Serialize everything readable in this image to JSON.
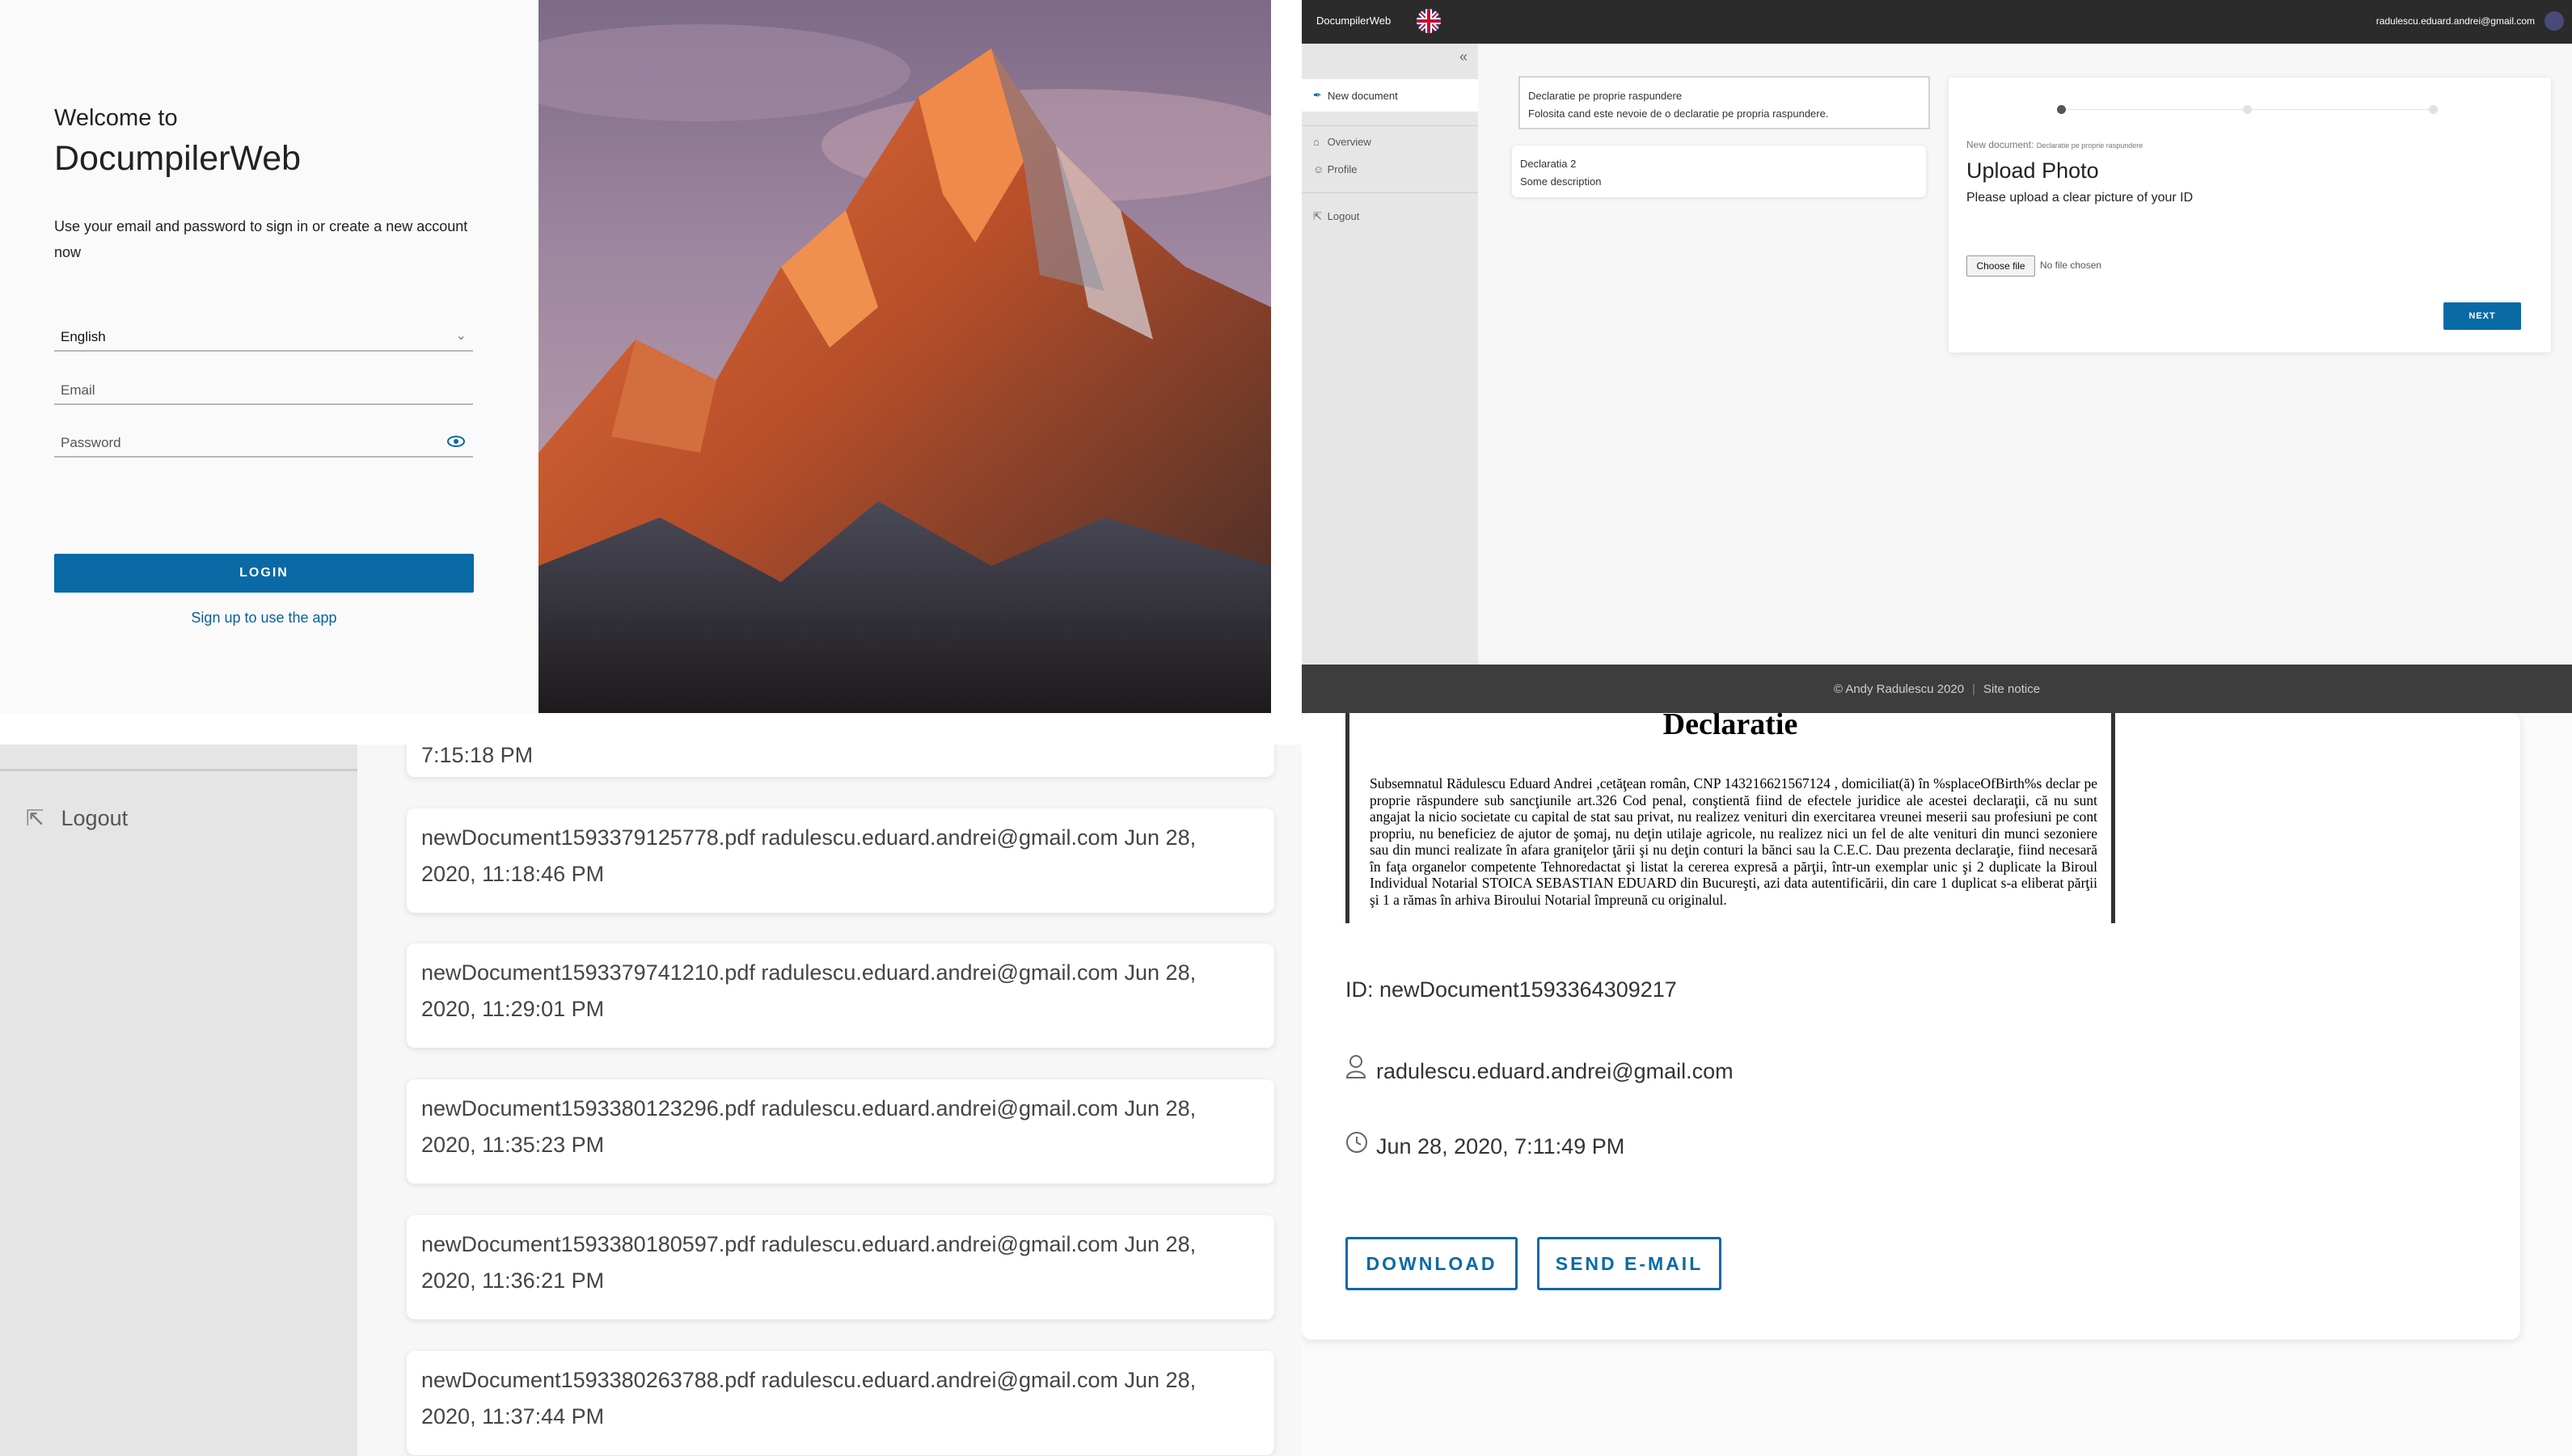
{
  "login": {
    "welcome": "Welcome to",
    "app_name": "DocumpilerWeb",
    "subtitle": "Use your email and password to sign in or create a new account now",
    "language": "English",
    "email_placeholder": "Email",
    "password_placeholder": "Password",
    "login_label": "LOGIN",
    "signup_label": "Sign up to use the app"
  },
  "upload": {
    "brand": "DocumpilerWeb",
    "user_email": "radulescu.eduard.andrei@gmail.com",
    "sidebar": {
      "new_document": "New document",
      "overview": "Overview",
      "profile": "Profile",
      "logout": "Logout"
    },
    "cards": [
      {
        "title": "Declaratie pe proprie raspundere",
        "description": "Folosita cand este nevoie de o declaratie pe propria raspundere."
      },
      {
        "title": "Declaratia 2",
        "description": "Some description"
      }
    ],
    "wizard": {
      "crumb": "New document:",
      "crumb_doc": "Declaratie pe proprie raspundere",
      "title": "Upload Photo",
      "instruction": "Please upload a clear picture of your ID",
      "choose_file": "Choose file",
      "no_file": "No file chosen",
      "next": "NEXT",
      "current_step": 1,
      "total_steps": 3
    },
    "footer": {
      "copyright": "© Andy Radulescu 2020",
      "site_notice": "Site notice"
    }
  },
  "list": {
    "partial_time": "7:15:18 PM",
    "logout": "Logout",
    "documents": [
      {
        "name": "newDocument1593379125778.pdf",
        "email": "radulescu.eduard.andrei@gmail.com",
        "date": "Jun 28,",
        "time": "2020, 11:18:46 PM"
      },
      {
        "name": "newDocument1593379741210.pdf",
        "email": "radulescu.eduard.andrei@gmail.com",
        "date": "Jun 28,",
        "time": "2020, 11:29:01 PM"
      },
      {
        "name": "newDocument1593380123296.pdf",
        "email": "radulescu.eduard.andrei@gmail.com",
        "date": "Jun 28,",
        "time": "2020, 11:35:23 PM"
      },
      {
        "name": "newDocument1593380180597.pdf",
        "email": "radulescu.eduard.andrei@gmail.com",
        "date": "Jun 28,",
        "time": "2020, 11:36:21 PM"
      },
      {
        "name": "newDocument1593380263788.pdf",
        "email": "radulescu.eduard.andrei@gmail.com",
        "date": "Jun 28,",
        "time": "2020, 11:37:44 PM"
      }
    ]
  },
  "detail": {
    "doc_heading": "Declaratie",
    "doc_body": "Subsemnatul Rădulescu Eduard Andrei ,cetăţean român, CNP 143216621567124 , domiciliat(ă) în %splaceOfBirth%s declar pe proprie răspundere sub sancţiunile art.326 Cod penal, conştientă fiind de efectele juridice ale acestei declaraţii, că nu sunt angajat la nicio societate cu capital de stat sau privat, nu realizez venituri din exercitarea vreunei meserii sau profesiuni pe cont propriu, nu beneficiez de ajutor de şomaj, nu deţin utilaje agricole, nu realizez nici un fel de alte venituri din munci sezoniere sau din munci realizate în afara graniţelor ţării şi nu deţin conturi la bănci sau la C.E.C. Dau prezenta declaraţie, fiind necesară în faţa organelor competente Tehnoredactat şi listat la cererea expresă a părţii, într-un exemplar unic şi 2 duplicate la Biroul Individual Notarial STOICA SEBASTIAN EDUARD din Bucureşti, azi data autentificării, din care 1 duplicat s-a eliberat părţii şi 1 a rămas în arhiva Biroului Notarial împreună cu originalul.",
    "id_text": "ID: newDocument1593364309217",
    "user_email": "radulescu.eduard.andrei@gmail.com",
    "created": "Jun 28, 2020, 7:11:49 PM",
    "download": "DOWNLOAD",
    "send_email": "SEND E-MAIL"
  },
  "colors": {
    "accent": "#0a6aa6",
    "header_dark": "#2b2b2b",
    "footer_dark": "#3d3d3d",
    "sidebar_gray": "#e5e5e5"
  },
  "icons": [
    "chevron-down-icon",
    "eye-icon",
    "uk-flag-icon",
    "double-chevron-left-icon",
    "new-document-icon",
    "overview-icon",
    "profile-icon",
    "logout-icon",
    "user-icon",
    "clock-icon"
  ]
}
